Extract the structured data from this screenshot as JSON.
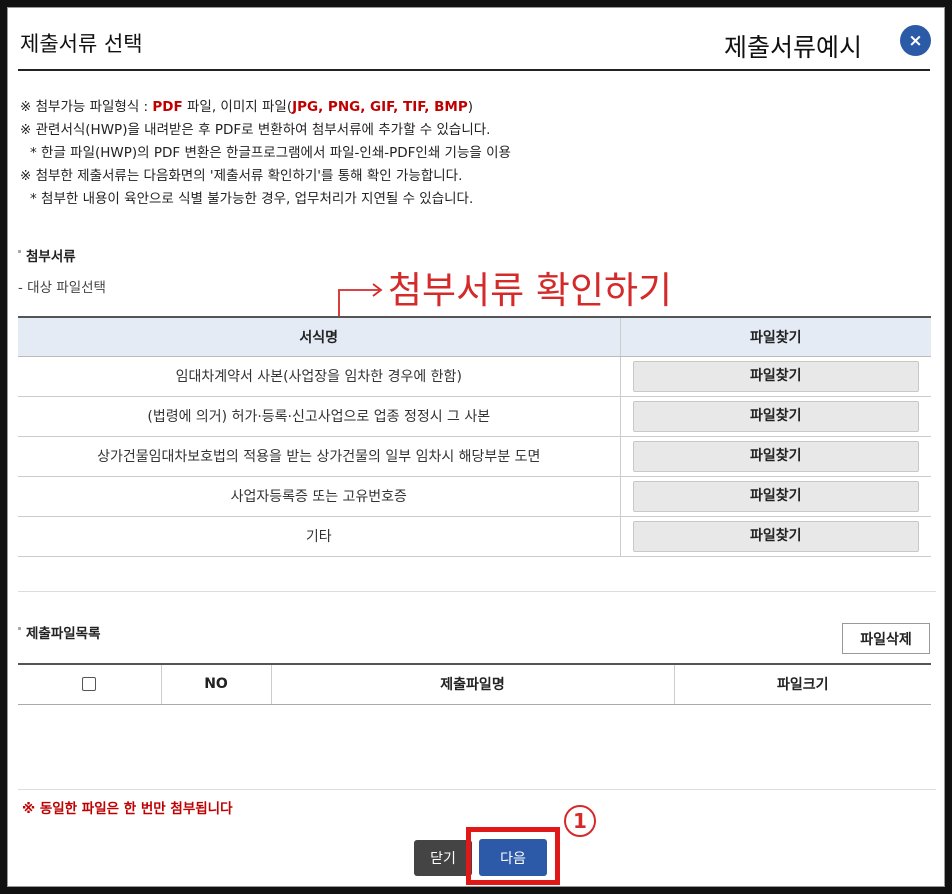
{
  "header": {
    "title": "제출서류 선택",
    "right_title": "제출서류예시",
    "close_label": "×"
  },
  "notes": [
    {
      "prefix": "※ 첨부가능 파일형식 : ",
      "pdf": "PDF",
      "mid": " 파일, 이미지 파일(",
      "formats": "JPG, PNG, GIF, TIF, BMP",
      "suffix": ")"
    },
    "※ 관련서식(HWP)을 내려받은 후 PDF로 변환하여 첨부서류에 추가할 수 있습니다.",
    " * 한글 파일(HWP)의 PDF 변환은 한글프로그램에서 파일-인쇄-PDF인쇄 기능을 이용",
    "※ 첨부한 제출서류는 다음화면의 '제출서류 확인하기'를 통해 확인 가능합니다.",
    " * 첨부한 내용이 육안으로 식별 불가능한 경우, 업무처리가 지연될 수 있습니다."
  ],
  "attach_section": {
    "heading": "첨부서류",
    "sub_label": "- 대상 파일선택",
    "annotation": "첨부서류 확인하기",
    "columns": [
      "서식명",
      "파일찾기"
    ],
    "rows": [
      {
        "name": "임대차계약서 사본(사업장을 임차한 경우에 한함)",
        "button": "파일찾기"
      },
      {
        "name": "(법령에 의거) 허가·등록·신고사업으로 업종 정정시 그 사본",
        "button": "파일찾기"
      },
      {
        "name": "상가건물임대차보호법의 적용을 받는 상가건물의 일부 임차시 해당부분 도면",
        "button": "파일찾기"
      },
      {
        "name": "사업자등록증 또는 고유번호증",
        "button": "파일찾기"
      },
      {
        "name": "기타",
        "button": "파일찾기"
      }
    ]
  },
  "file_section": {
    "heading": "제출파일목록",
    "delete_button": "파일삭제",
    "columns": [
      "NO",
      "제출파일명",
      "파일크기"
    ]
  },
  "warning": "※ 동일한 파일은 한 번만 첨부됩니다",
  "footer": {
    "close_button": "닫기",
    "next_button": "다음",
    "step_marker": "1"
  }
}
